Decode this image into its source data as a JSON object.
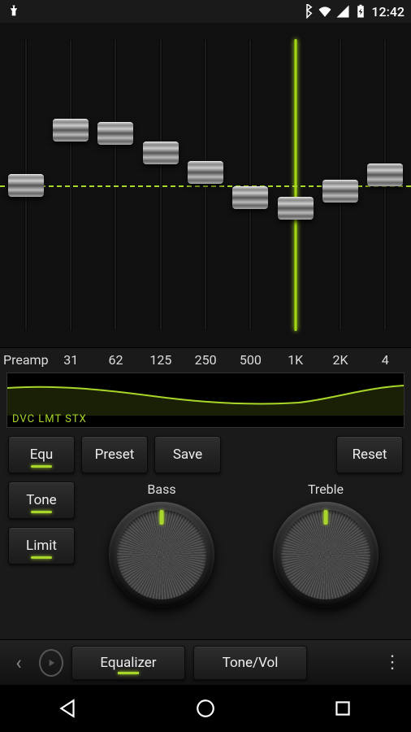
{
  "statusbar": {
    "time": "12:42"
  },
  "eq": {
    "bands": [
      {
        "label": "Preamp",
        "value": 0
      },
      {
        "label": "31",
        "value": 42
      },
      {
        "label": "62",
        "value": 40
      },
      {
        "label": "125",
        "value": 25
      },
      {
        "label": "250",
        "value": 10
      },
      {
        "label": "500",
        "value": -10
      },
      {
        "label": "1K",
        "value": -18,
        "highlight": true
      },
      {
        "label": "2K",
        "value": -5
      },
      {
        "label": "4",
        "value": 8
      }
    ],
    "indicators": "DVC LMT STX"
  },
  "buttons": {
    "equ": "Equ",
    "preset": "Preset",
    "save": "Save",
    "reset": "Reset",
    "tone": "Tone",
    "limit": "Limit"
  },
  "dials": {
    "bass_label": "Bass",
    "treble_label": "Treble"
  },
  "tabs": {
    "equalizer": "Equalizer",
    "tonevol": "Tone/Vol"
  }
}
